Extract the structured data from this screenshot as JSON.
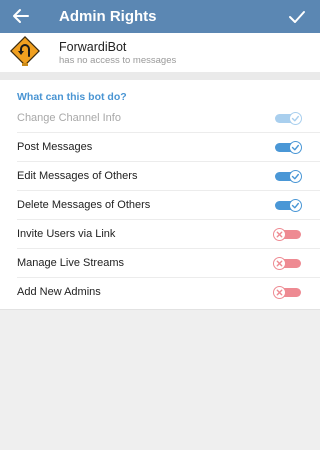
{
  "toolbar": {
    "title": "Admin Rights",
    "back_icon": "arrow-left-icon",
    "done_icon": "checkmark-icon",
    "background_color": "#5b87b3"
  },
  "bot": {
    "name": "ForwardiBot",
    "status": "has no access to messages",
    "avatar_icon": "road-sign-u-turn-icon",
    "avatar_color": "#f0a020"
  },
  "permissions": {
    "header": "What can this bot do?",
    "header_color": "#4a95d3",
    "on_color": "#4a97d6",
    "off_color": "#ee8a92",
    "items": [
      {
        "label": "Change Channel Info",
        "enabled": true,
        "disabled": true
      },
      {
        "label": "Post Messages",
        "enabled": true,
        "disabled": false
      },
      {
        "label": "Edit Messages of Others",
        "enabled": true,
        "disabled": false
      },
      {
        "label": "Delete Messages of Others",
        "enabled": true,
        "disabled": false
      },
      {
        "label": "Invite Users via Link",
        "enabled": false,
        "disabled": false
      },
      {
        "label": "Manage Live Streams",
        "enabled": false,
        "disabled": false
      },
      {
        "label": "Add New Admins",
        "enabled": false,
        "disabled": false
      }
    ]
  }
}
